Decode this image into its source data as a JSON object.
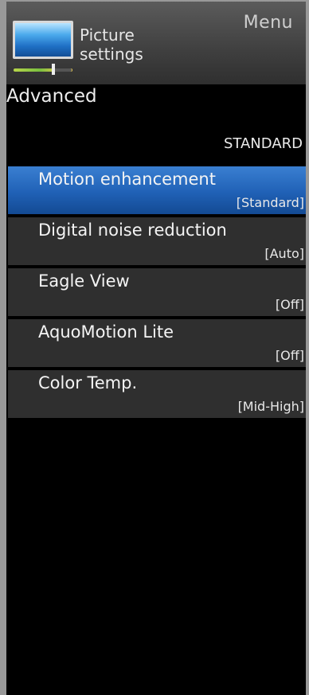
{
  "header": {
    "title": "Picture settings",
    "menu_label": "Menu"
  },
  "section": {
    "title": "Advanced",
    "mode": "STANDARD"
  },
  "menu": {
    "items": [
      {
        "label": "Motion enhancement",
        "value": "[Standard]"
      },
      {
        "label": "Digital noise reduction",
        "value": "[Auto]"
      },
      {
        "label": "Eagle View",
        "value": "[Off]"
      },
      {
        "label": "AquoMotion Lite",
        "value": "[Off]"
      },
      {
        "label": "Color Temp.",
        "value": "[Mid-High]"
      }
    ],
    "selected_index": 0
  },
  "colors": {
    "selected_item": "#2061b6",
    "item_background": "#2f2f2f",
    "header_background": "#4a4a4a",
    "page_background": "#000000"
  },
  "icons": {
    "header_icon": "picture-settings-icon"
  }
}
